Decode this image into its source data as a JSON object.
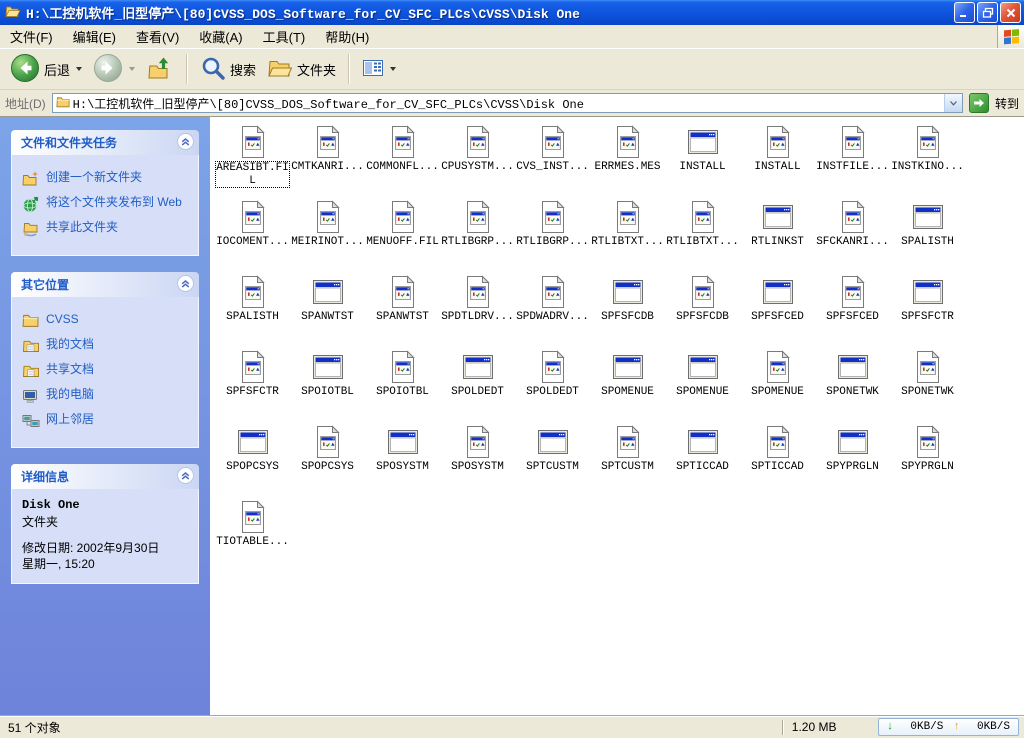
{
  "window": {
    "title": "H:\\工控机软件_旧型停产\\[80]CVSS_DOS_Software_for_CV_SFC_PLCs\\CVSS\\Disk One"
  },
  "menu": {
    "items": [
      {
        "label": "文件(F)"
      },
      {
        "label": "编辑(E)"
      },
      {
        "label": "查看(V)"
      },
      {
        "label": "收藏(A)"
      },
      {
        "label": "工具(T)"
      },
      {
        "label": "帮助(H)"
      }
    ]
  },
  "toolbar": {
    "back_label": "后退",
    "search_label": "搜索",
    "folders_label": "文件夹"
  },
  "address": {
    "label": "地址(D)",
    "value": "H:\\工控机软件_旧型停产\\[80]CVSS_DOS_Software_for_CV_SFC_PLCs\\CVSS\\Disk One",
    "go_label": "转到"
  },
  "sidebar": {
    "panels": [
      {
        "id": "tasks",
        "title": "文件和文件夹任务",
        "items": [
          {
            "icon": "new-folder",
            "label": "创建一个新文件夹"
          },
          {
            "icon": "publish-web",
            "label": "将这个文件夹发布到 Web"
          },
          {
            "icon": "share-folder",
            "label": "共享此文件夹"
          }
        ]
      },
      {
        "id": "places",
        "title": "其它位置",
        "items": [
          {
            "icon": "folder",
            "label": "CVSS"
          },
          {
            "icon": "my-documents",
            "label": "我的文档"
          },
          {
            "icon": "shared-documents",
            "label": "共享文档"
          },
          {
            "icon": "my-computer",
            "label": "我的电脑"
          },
          {
            "icon": "network",
            "label": "网上邻居"
          }
        ]
      },
      {
        "id": "details",
        "title": "详细信息",
        "lines": [
          "Disk One",
          "文件夹",
          "",
          "修改日期: 2002年9月30日",
          "星期一, 15:20"
        ]
      }
    ]
  },
  "files": [
    {
      "label": "AREASIBT.FIL",
      "icon": "file",
      "selected": true
    },
    {
      "label": "CMTKANRI...",
      "icon": "file"
    },
    {
      "label": "COMMONFL...",
      "icon": "file"
    },
    {
      "label": "CPUSYSTM...",
      "icon": "file"
    },
    {
      "label": "CVS_INST...",
      "icon": "file"
    },
    {
      "label": "ERRMES.MES",
      "icon": "file"
    },
    {
      "label": "INSTALL",
      "icon": "app"
    },
    {
      "label": "INSTALL",
      "icon": "file"
    },
    {
      "label": "INSTFILE...",
      "icon": "file"
    },
    {
      "label": "INSTKINO...",
      "icon": "file"
    },
    {
      "label": "IOCOMENT...",
      "icon": "file"
    },
    {
      "label": "MEIRINOT...",
      "icon": "file"
    },
    {
      "label": "MENUOFF.FIL",
      "icon": "file"
    },
    {
      "label": "RTLIBGRP...",
      "icon": "file"
    },
    {
      "label": "RTLIBGRP...",
      "icon": "file"
    },
    {
      "label": "RTLIBTXT...",
      "icon": "file"
    },
    {
      "label": "RTLIBTXT...",
      "icon": "file"
    },
    {
      "label": "RTLINKST",
      "icon": "app"
    },
    {
      "label": "SFCKANRI...",
      "icon": "file"
    },
    {
      "label": "SPALISTH",
      "icon": "app"
    },
    {
      "label": "SPALISTH",
      "icon": "file"
    },
    {
      "label": "SPANWTST",
      "icon": "app"
    },
    {
      "label": "SPANWTST",
      "icon": "file"
    },
    {
      "label": "SPDTLDRV...",
      "icon": "file"
    },
    {
      "label": "SPDWADRV...",
      "icon": "file"
    },
    {
      "label": "SPFSFCDB",
      "icon": "app"
    },
    {
      "label": "SPFSFCDB",
      "icon": "file"
    },
    {
      "label": "SPFSFCED",
      "icon": "app"
    },
    {
      "label": "SPFSFCED",
      "icon": "file"
    },
    {
      "label": "SPFSFCTR",
      "icon": "app"
    },
    {
      "label": "SPFSFCTR",
      "icon": "file"
    },
    {
      "label": "SPOIOTBL",
      "icon": "app"
    },
    {
      "label": "SPOIOTBL",
      "icon": "file"
    },
    {
      "label": "SPOLDEDT",
      "icon": "app"
    },
    {
      "label": "SPOLDEDT",
      "icon": "file"
    },
    {
      "label": "SPOMENUE",
      "icon": "app"
    },
    {
      "label": "SPOMENUE",
      "icon": "app"
    },
    {
      "label": "SPOMENUE",
      "icon": "file"
    },
    {
      "label": "SPONETWK",
      "icon": "app"
    },
    {
      "label": "SPONETWK",
      "icon": "file"
    },
    {
      "label": "SPOPCSYS",
      "icon": "app"
    },
    {
      "label": "SPOPCSYS",
      "icon": "file"
    },
    {
      "label": "SPOSYSTM",
      "icon": "app"
    },
    {
      "label": "SPOSYSTM",
      "icon": "file"
    },
    {
      "label": "SPTCUSTM",
      "icon": "app"
    },
    {
      "label": "SPTCUSTM",
      "icon": "file"
    },
    {
      "label": "SPTICCAD",
      "icon": "app"
    },
    {
      "label": "SPTICCAD",
      "icon": "file"
    },
    {
      "label": "SPYPRGLN",
      "icon": "app"
    },
    {
      "label": "SPYPRGLN",
      "icon": "file"
    },
    {
      "label": "TIOTABLE...",
      "icon": "file"
    }
  ],
  "statusbar": {
    "objects_label": "51 个对象",
    "size_label": "1.20 MB",
    "down_speed": "0KB/S",
    "up_speed": "0KB/S"
  },
  "colors": {
    "titlebar_blue": "#0d53dc",
    "close_red": "#e0583b",
    "toolbar_beige": "#ece9d8",
    "sidebar_blue": "#7ca4e8",
    "panel_body_blue": "#d6dff7",
    "link_blue": "#215dc6",
    "icon_titlebar_blue": "#1030c8",
    "status_down_green": "#18a018",
    "status_up_orange": "#e8a020"
  }
}
